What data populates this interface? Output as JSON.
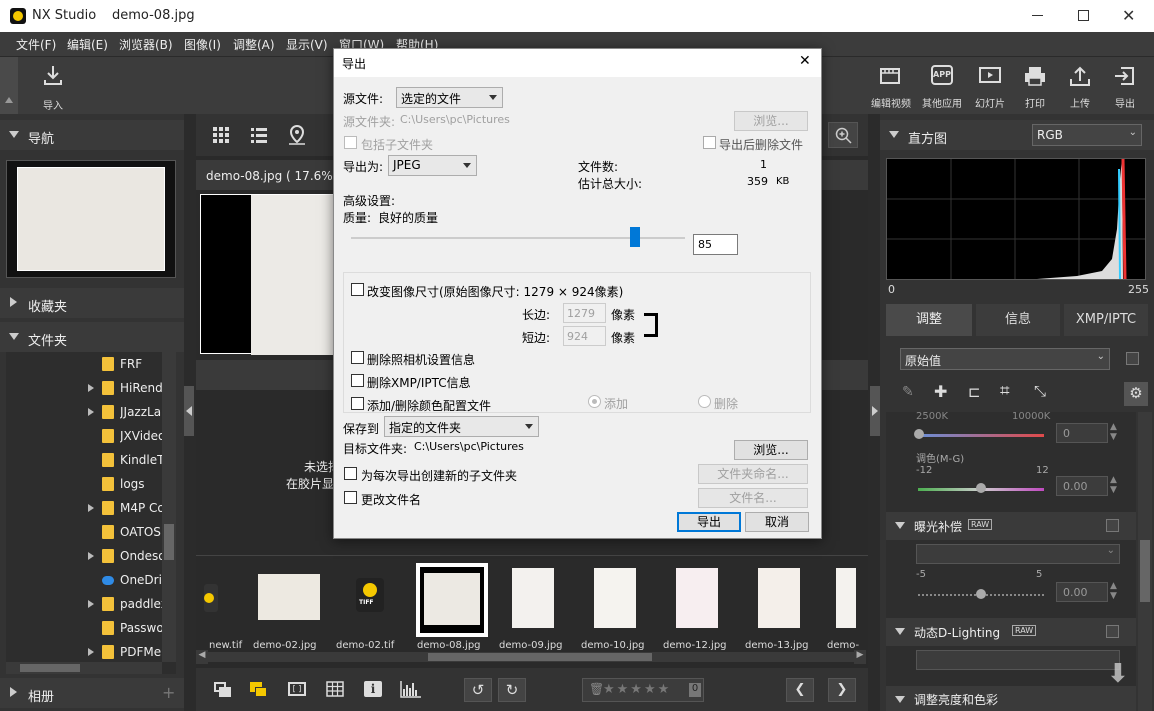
{
  "window": {
    "app_name": "NX Studio",
    "file_name": "demo-08.jpg"
  },
  "menu": [
    "文件(F)",
    "编辑(E)",
    "浏览器(B)",
    "图像(I)",
    "调整(A)",
    "显示(V)",
    "窗口(W)",
    "帮助(H)"
  ],
  "toolbar": {
    "import_label": "导入",
    "right_items": [
      "编辑视频",
      "其他应用",
      "幻灯片",
      "打印",
      "上传",
      "导出"
    ],
    "app_badge": "APP"
  },
  "left": {
    "nav_label": "导航",
    "favorites_label": "收藏夹",
    "folders_label": "文件夹",
    "albums_label": "相册",
    "folders": [
      "FRF",
      "HiRend",
      "JJazzLab",
      "JXVideo",
      "KindleT",
      "logs",
      "M4P Co",
      "OATOS",
      "Ondeso",
      "OneDriv",
      "paddlex",
      "Passwo",
      "PDFMer"
    ]
  },
  "center": {
    "image_caption": "demo-08.jpg ( 17.6% )",
    "no_selection_line1": "未选择",
    "no_selection_line2": "在胶片显",
    "filmstrip": [
      "new.tif",
      "demo-02.jpg",
      "demo-02.tif",
      "demo-08.jpg",
      "demo-09.jpg",
      "demo-10.jpg",
      "demo-12.jpg",
      "demo-13.jpg",
      "demo-"
    ],
    "tiff_badge": "TIFF",
    "rating_count": "0"
  },
  "right": {
    "histogram_label": "直方图",
    "histogram_mode": "RGB",
    "hist_min": "0",
    "hist_max": "255",
    "tabs": [
      "调整",
      "信息",
      "XMP/IPTC"
    ],
    "preset": "原始值",
    "wb_left": "2500K",
    "wb_right": "10000K",
    "wb_value": "0",
    "tint_label": "调色(M-G)",
    "tint_min": "-12",
    "tint_max": "12",
    "tint_value": "0.00",
    "exposure_label": "曝光补偿",
    "raw_badge": "RAW",
    "exp_min": "-5",
    "exp_max": "5",
    "exp_value": "0.00",
    "adl_label": "动态D-Lighting",
    "bottom_label": "调整亮度和色彩"
  },
  "dialog": {
    "title": "导出",
    "source_label": "源文件:",
    "source_value": "选定的文件",
    "source_folder_label": "源文件夹:",
    "source_folder_value": "C:\\Users\\pc\\Pictures",
    "browse_disabled": "浏览...",
    "include_subfolders": "包括子文件夹",
    "delete_after_export": "导出后删除文件",
    "export_as_label": "导出为:",
    "export_as_value": "JPEG",
    "file_count_label": "文件数:",
    "file_count_value": "1",
    "est_size_label": "估计总大小:",
    "est_size_value": "359",
    "est_size_unit": "KB",
    "advanced_label": "高级设置:",
    "quality_label": "质量:",
    "quality_text": "良好的质量",
    "quality_value": "85",
    "quality_fraction": 0.85,
    "resize_label": "改变图像尺寸(原始图像尺寸: 1279 × 924像素)",
    "long_side_label": "长边:",
    "long_side_value": "1279",
    "short_side_label": "短边:",
    "short_side_value": "924",
    "pixel_unit": "像素",
    "delete_camera_info": "删除照相机设置信息",
    "delete_xmp": "删除XMP/IPTC信息",
    "add_remove_profile": "添加/删除颜色配置文件",
    "radio_add": "添加",
    "radio_delete": "删除",
    "save_to_label": "保存到",
    "save_to_value": "指定的文件夹",
    "target_folder_label": "目标文件夹:",
    "target_folder_value": "C:\\Users\\pc\\Pictures",
    "browse": "浏览...",
    "create_subfolder": "为每次导出创建新的子文件夹",
    "folder_naming": "文件夹命名...",
    "rename_files": "更改文件名",
    "file_naming": "文件名...",
    "export_button": "导出",
    "cancel_button": "取消"
  }
}
